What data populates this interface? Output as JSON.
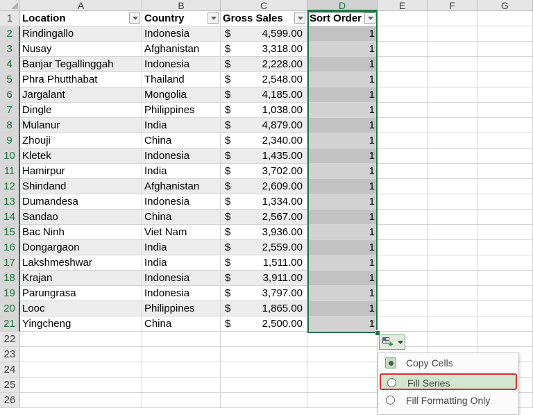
{
  "columns": [
    "A",
    "B",
    "C",
    "D",
    "E",
    "F",
    "G"
  ],
  "headers": {
    "location": "Location",
    "country": "Country",
    "gross_sales": "Gross Sales",
    "sort_order": "Sort Order"
  },
  "currency_symbol": "$",
  "rows": [
    {
      "row": "2",
      "location": "Rindingallo",
      "country": "Indonesia",
      "sales": "4,599.00",
      "sort": "1"
    },
    {
      "row": "3",
      "location": "Nusay",
      "country": "Afghanistan",
      "sales": "3,318.00",
      "sort": "1"
    },
    {
      "row": "4",
      "location": "Banjar Tegallinggah",
      "country": "Indonesia",
      "sales": "2,228.00",
      "sort": "1"
    },
    {
      "row": "5",
      "location": "Phra Phutthabat",
      "country": "Thailand",
      "sales": "2,548.00",
      "sort": "1"
    },
    {
      "row": "6",
      "location": "Jargalant",
      "country": "Mongolia",
      "sales": "4,185.00",
      "sort": "1"
    },
    {
      "row": "7",
      "location": "Dingle",
      "country": "Philippines",
      "sales": "1,038.00",
      "sort": "1"
    },
    {
      "row": "8",
      "location": "Mulanur",
      "country": "India",
      "sales": "4,879.00",
      "sort": "1"
    },
    {
      "row": "9",
      "location": "Zhouji",
      "country": "China",
      "sales": "2,340.00",
      "sort": "1"
    },
    {
      "row": "10",
      "location": "Kletek",
      "country": "Indonesia",
      "sales": "1,435.00",
      "sort": "1"
    },
    {
      "row": "11",
      "location": "Hamirpur",
      "country": "India",
      "sales": "3,702.00",
      "sort": "1"
    },
    {
      "row": "12",
      "location": "Shindand",
      "country": "Afghanistan",
      "sales": "2,609.00",
      "sort": "1"
    },
    {
      "row": "13",
      "location": "Dumandesa",
      "country": "Indonesia",
      "sales": "1,334.00",
      "sort": "1"
    },
    {
      "row": "14",
      "location": "Sandao",
      "country": "China",
      "sales": "2,567.00",
      "sort": "1"
    },
    {
      "row": "15",
      "location": "Bac Ninh",
      "country": "Viet Nam",
      "sales": "3,936.00",
      "sort": "1"
    },
    {
      "row": "16",
      "location": "Dongargaon",
      "country": "India",
      "sales": "2,559.00",
      "sort": "1"
    },
    {
      "row": "17",
      "location": "Lakshmeshwar",
      "country": "India",
      "sales": "1,511.00",
      "sort": "1"
    },
    {
      "row": "18",
      "location": "Krajan",
      "country": "Indonesia",
      "sales": "3,911.00",
      "sort": "1"
    },
    {
      "row": "19",
      "location": "Parungrasa",
      "country": "Indonesia",
      "sales": "3,797.00",
      "sort": "1"
    },
    {
      "row": "20",
      "location": "Looc",
      "country": "Philippines",
      "sales": "1,865.00",
      "sort": "1"
    },
    {
      "row": "21",
      "location": "Yingcheng",
      "country": "China",
      "sales": "2,500.00",
      "sort": "1"
    }
  ],
  "header_row_number": "1",
  "empty_rows": [
    "22",
    "23",
    "24",
    "25",
    "26"
  ],
  "selected_column": "D",
  "autofill_menu": {
    "items": [
      {
        "label": "Copy Cells",
        "selected": true
      },
      {
        "label": "Fill Series",
        "selected": false,
        "highlighted": true
      },
      {
        "label": "Fill Formatting Only",
        "selected": false
      }
    ]
  },
  "colors": {
    "selection": "#217346",
    "highlight_border": "#d13438",
    "band_row": "#ececec"
  }
}
